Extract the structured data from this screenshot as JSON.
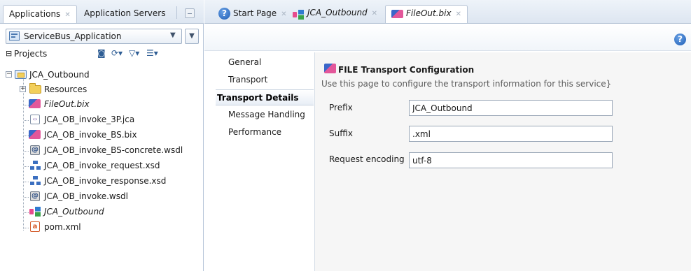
{
  "left_panel": {
    "tabs": [
      {
        "label": "Applications",
        "active": true
      },
      {
        "label": "Application Servers",
        "active": false
      }
    ],
    "application_selector": {
      "value": "ServiceBus_Application"
    },
    "projects_label": "Projects",
    "tree": {
      "root": {
        "label": "JCA_Outbound",
        "icon": "project-icon"
      },
      "items": [
        {
          "label": "Resources",
          "icon": "folder-icon",
          "italic": false
        },
        {
          "label": "FileOut.bix",
          "icon": "business-service-icon",
          "italic": true
        },
        {
          "label": "JCA_OB_invoke_3P.jca",
          "icon": "jca-file-icon",
          "italic": false
        },
        {
          "label": "JCA_OB_invoke_BS.bix",
          "icon": "business-service-icon",
          "italic": false
        },
        {
          "label": "JCA_OB_invoke_BS-concrete.wsdl",
          "icon": "wsdl-icon",
          "italic": false
        },
        {
          "label": "JCA_OB_invoke_request.xsd",
          "icon": "xsd-icon",
          "italic": false
        },
        {
          "label": "JCA_OB_invoke_response.xsd",
          "icon": "xsd-icon",
          "italic": false
        },
        {
          "label": "JCA_OB_invoke.wsdl",
          "icon": "wsdl-icon",
          "italic": false
        },
        {
          "label": "JCA_Outbound",
          "icon": "pipeline-icon",
          "italic": true
        },
        {
          "label": "pom.xml",
          "icon": "maven-pom-icon",
          "italic": false
        }
      ]
    }
  },
  "editor": {
    "tabs": [
      {
        "label": "Start Page",
        "active": false,
        "italic": false
      },
      {
        "label": "JCA_Outbound",
        "active": false,
        "italic": true
      },
      {
        "label": "FileOut.bix",
        "active": true,
        "italic": true
      }
    ],
    "nav": [
      {
        "label": "General",
        "selected": false
      },
      {
        "label": "Transport",
        "selected": false
      },
      {
        "label": "Transport Details",
        "selected": true
      },
      {
        "label": "Message Handling",
        "selected": false
      },
      {
        "label": "Performance",
        "selected": false
      }
    ],
    "section_title": "FILE Transport Configuration",
    "section_description": "Use this page to configure the transport information for this service}",
    "fields": [
      {
        "label": "Prefix",
        "value": "JCA_Outbound"
      },
      {
        "label": "Suffix",
        "value": ".xml"
      },
      {
        "label": "Request encoding",
        "value": "utf-8"
      }
    ]
  },
  "colors": {
    "accent_blue": "#2f5e95",
    "tab_bar": "#dde6f1",
    "form_background": "#f6f6f6"
  }
}
